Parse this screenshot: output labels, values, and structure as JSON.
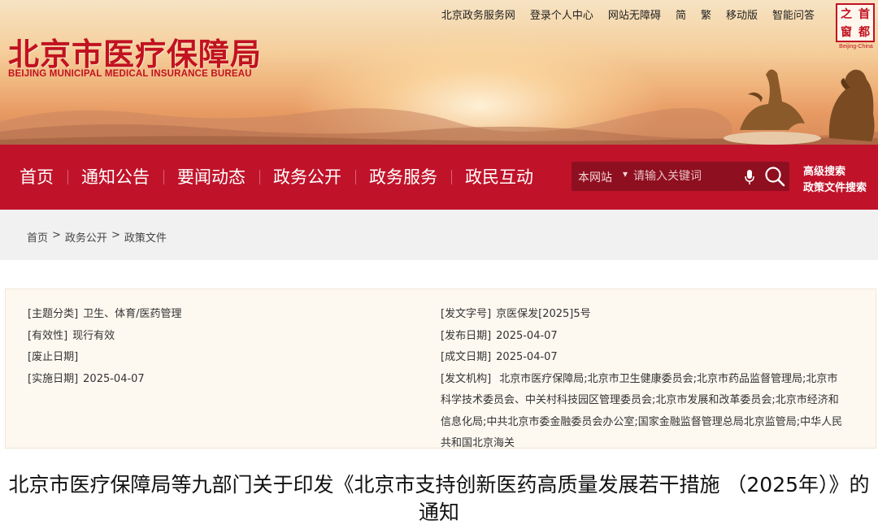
{
  "top_links": [
    "北京政务服务网",
    "登录个人中心",
    "网站无障碍",
    "简",
    "繁",
    "移动版",
    "智能问答"
  ],
  "logo": {
    "name_cn": "北京市医疗保障局",
    "name_en": "BEIJING MUNICIPAL MEDICAL INSURANCE BUREAU"
  },
  "seal": {
    "chars": [
      "首",
      "都",
      "之",
      "窗"
    ],
    "caption": "Beijing-China"
  },
  "nav": [
    "首页",
    "通知公告",
    "要闻动态",
    "政务公开",
    "政务服务",
    "政民互动"
  ],
  "search": {
    "scope": "本网站",
    "placeholder": "请输入关键词"
  },
  "advanced": {
    "advanced_search": "高级搜索",
    "policy_search": "政策文件搜索"
  },
  "breadcrumb": [
    "首页",
    "政务公开",
    "政策文件"
  ],
  "breadcrumb_sep": ">",
  "info": {
    "left": [
      {
        "k": "[主题分类]",
        "v": "卫生、体育/医药管理"
      },
      {
        "k": "[有效性]",
        "v": "现行有效"
      },
      {
        "k": "[废止日期]",
        "v": ""
      },
      {
        "k": "[实施日期]",
        "v": "2025-04-07"
      }
    ],
    "right": [
      {
        "k": "[发文字号]",
        "v": "京医保发[2025]5号"
      },
      {
        "k": "[发布日期]",
        "v": "2025-04-07"
      },
      {
        "k": "[成文日期]",
        "v": "2025-04-07"
      },
      {
        "k": "[发文机构]",
        "v": "北京市医疗保障局;北京市卫生健康委员会;北京市药品监督管理局;北京市科学技术委员会、中关村科技园区管理委员会;北京市发展和改革委员会;北京市经济和信息化局;中共北京市委金融委员会办公室;国家金融监督管理总局北京监管局;中华人民共和国北京海关"
      }
    ]
  },
  "document_title": "北京市医疗保障局等九部门关于印发《北京市支持创新医药高质量发展若干措施 （2025年）》的通知",
  "colors": {
    "primary_red": "#c0132a",
    "search_bg": "#8e0f1f",
    "info_bg": "#fdf8f0"
  }
}
